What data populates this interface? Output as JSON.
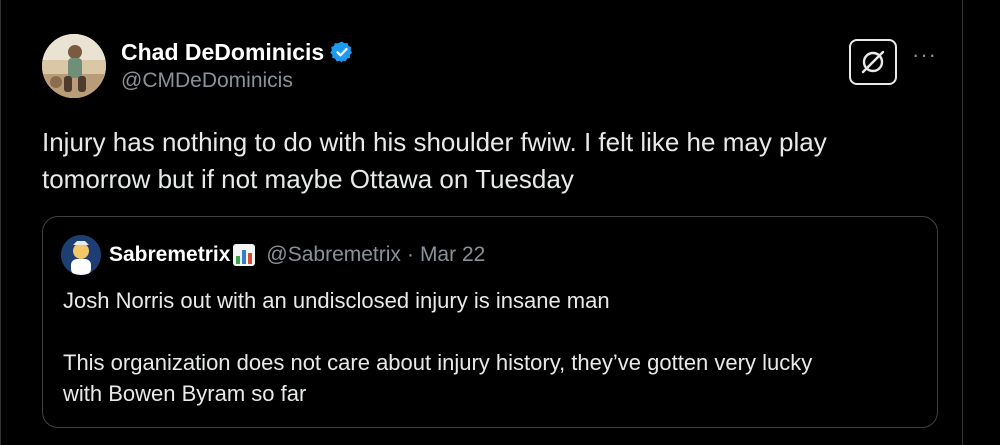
{
  "colors": {
    "background": "#000000",
    "text_primary": "#e7e9ea",
    "text_secondary": "#8b9198",
    "verified_blue": "#1d9bf0",
    "border": "#3e4144"
  },
  "tweet": {
    "display_name": "Chad DeDominicis",
    "handle": "@CMDeDominicis",
    "verified_icon": "verified-badge-icon",
    "action_icon": "slashed-circle-icon",
    "more_label": "···",
    "text": "Injury has nothing to do with his shoulder fwiw. I felt like he may play\ntomorrow but if not maybe Ottawa on Tuesday"
  },
  "quote": {
    "display_name": "Sabremetrix",
    "name_emoji_icon": "bar-chart-emoji-icon",
    "handle": "@Sabremetrix",
    "separator": "·",
    "date": "Mar 22",
    "text": "Josh Norris out with an undisclosed injury is insane man\n\nThis organization does not care about injury history, they’ve gotten very lucky\nwith Bowen Byram so far"
  }
}
